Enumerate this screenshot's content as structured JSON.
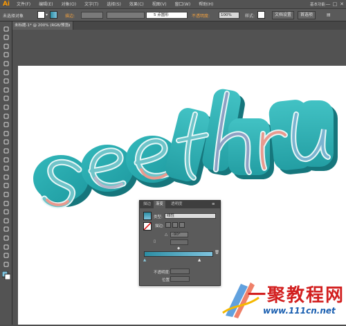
{
  "app": {
    "logo": "Ai",
    "workspace": "基本功能",
    "window_buttons": [
      "—",
      "□",
      "✕"
    ]
  },
  "menu": [
    "文件(F)",
    "编辑(E)",
    "对象(O)",
    "文字(T)",
    "选择(S)",
    "效果(C)",
    "视图(V)",
    "窗口(W)",
    "帮助(H)"
  ],
  "control_bar": {
    "selection_label": "未选择对象",
    "stroke_label": "描边:",
    "stroke_value": "",
    "brush_value": "5 点圆形",
    "opacity_label": "不透明度:",
    "opacity_value": "100%",
    "style_label": "样式:",
    "doc_setup": "文档设置",
    "preferences": "首选项"
  },
  "document": {
    "tab_title": "未标题-1* @ 200% (RGB/预览)",
    "close": "×"
  },
  "artwork": {
    "text": "see thru",
    "colors": {
      "face": "#2aa9ae",
      "side": "#1a8086",
      "highlight": "#7ee0e3",
      "pink": "#e99a8f"
    }
  },
  "gradient_panel": {
    "tabs": [
      "描边",
      "渐变",
      "透明度"
    ],
    "type_label": "类型:",
    "type_value": "线性",
    "stroke_label": "描边:",
    "angle_value": "-90°",
    "opacity_label": "不透明度:",
    "position_label": "位置:",
    "gradient_colors": [
      "#2c8ea4",
      "#7fc4df"
    ]
  },
  "watermark": {
    "text": "一聚教程网",
    "url": "www.111cn.net"
  }
}
